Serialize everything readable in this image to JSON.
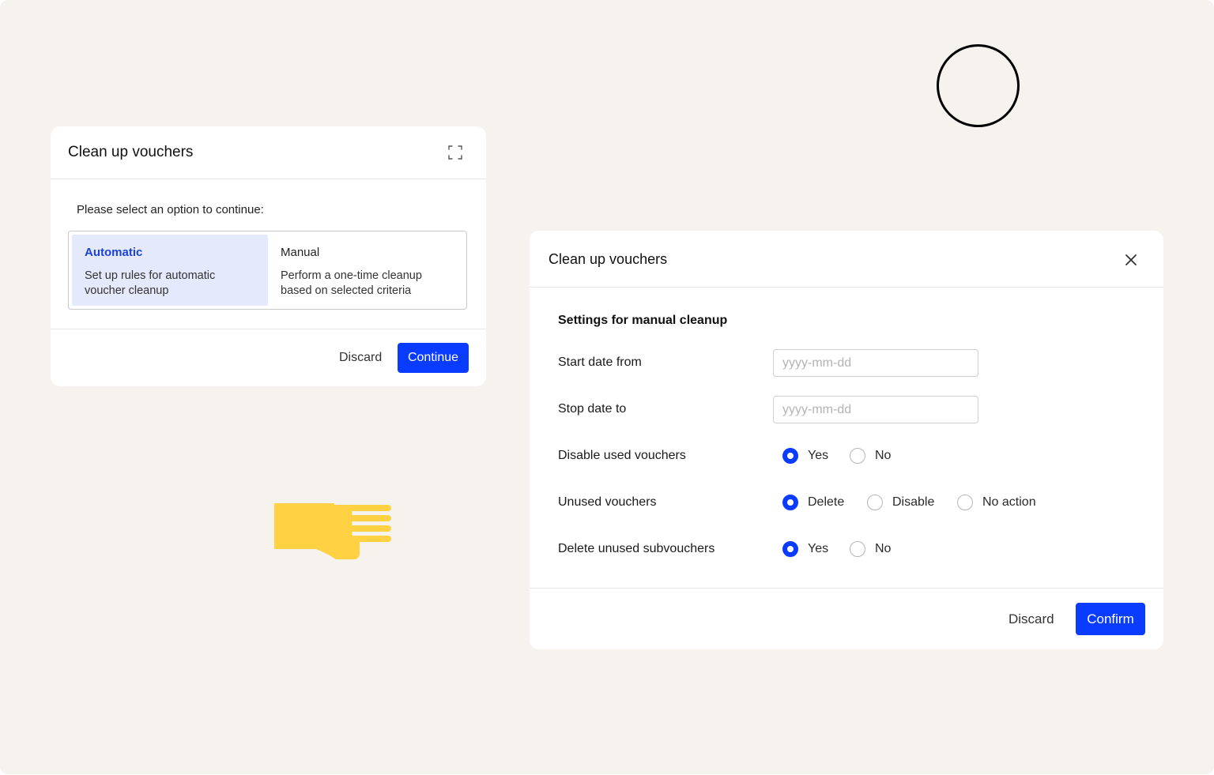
{
  "selection_dialog": {
    "title": "Clean up vouchers",
    "prompt": "Please select an option to continue:",
    "options": [
      {
        "title": "Automatic",
        "description": "Set up rules for automatic voucher cleanup",
        "selected": true
      },
      {
        "title": "Manual",
        "description": "Perform a one-time cleanup based on selected criteria",
        "selected": false
      }
    ],
    "discard_label": "Discard",
    "continue_label": "Continue"
  },
  "settings_dialog": {
    "title": "Clean up vouchers",
    "section_title": "Settings for manual cleanup",
    "start_date": {
      "label": "Start date from",
      "value": "",
      "placeholder": "yyyy-mm-dd"
    },
    "stop_date": {
      "label": "Stop date to",
      "value": "",
      "placeholder": "yyyy-mm-dd"
    },
    "disable_used": {
      "label": "Disable used vouchers",
      "options": [
        "Yes",
        "No"
      ],
      "selected": "Yes"
    },
    "unused_vouchers": {
      "label": "Unused vouchers",
      "options": [
        "Delete",
        "Disable",
        "No action"
      ],
      "selected": "Delete"
    },
    "delete_subvouchers": {
      "label": "Delete unused subvouchers",
      "options": [
        "Yes",
        "No"
      ],
      "selected": "Yes"
    },
    "discard_label": "Discard",
    "confirm_label": "Confirm"
  },
  "icons": {
    "expand": "expand-corners-icon",
    "close": "close-icon",
    "circle": "circle-outline-icon",
    "hand": "pointing-hand-icon"
  },
  "colors": {
    "background": "#f6f3ef",
    "primary": "#0a3cff",
    "selected_option_bg": "#e4e9fc",
    "selected_option_text": "#1c43d6",
    "hand": "#ffd143"
  }
}
